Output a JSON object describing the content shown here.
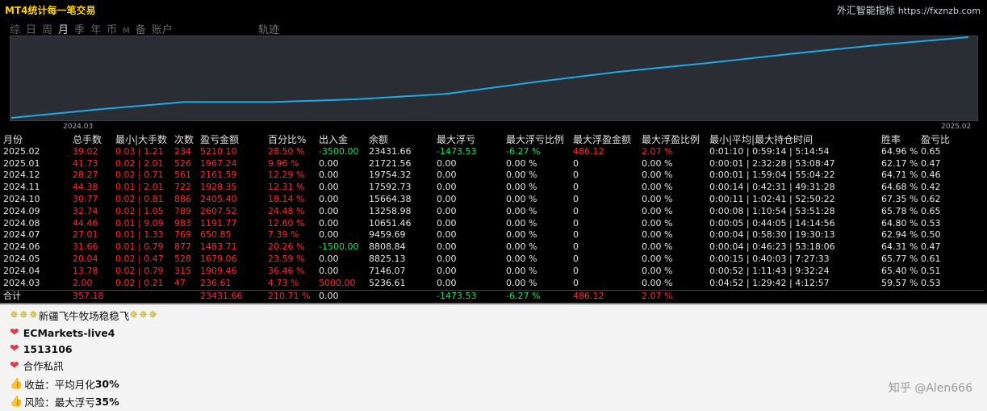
{
  "header": {
    "title": "MT4统计每一笔交易",
    "brand_name": "外汇智能指标",
    "brand_url": "https://fxznzb.com"
  },
  "tabs": [
    "综",
    "日",
    "周",
    "月",
    "季",
    "年",
    "币",
    "M",
    "备",
    "账户"
  ],
  "active_tab": "月",
  "track_label": "轨迹",
  "chart_data": {
    "type": "line",
    "x": [
      "2024.03",
      "2024.04",
      "2024.05",
      "2024.06",
      "2024.07",
      "2024.08",
      "2024.09",
      "2024.10",
      "2024.11",
      "2024.12",
      "2025.01",
      "2025.02"
    ],
    "series": [
      {
        "values": [
          5236.61,
          7146.07,
          8825.13,
          8808.84,
          9459.69,
          10651.46,
          13258.98,
          15664.38,
          17592.73,
          19754.32,
          21721.56,
          23431.66
        ]
      }
    ],
    "tick_labels": [
      "2024.03",
      "2025.02"
    ],
    "line_color": "#20a8e8"
  },
  "table": {
    "headers": [
      "月份",
      "总手数",
      "最小|大手数",
      "次数",
      "盈亏金额",
      "百分比%",
      "出入金",
      "余额",
      "最大浮亏",
      "最大浮亏比例",
      "最大浮盈金额",
      "最大浮盈比例",
      "最小|平均|最大持仓时间",
      "胜率",
      "盈亏比"
    ],
    "rows": [
      [
        "2025.02",
        "39.02",
        "0.03 | 1.21",
        "234",
        "5210.10",
        "28.50 %",
        "-3500.00",
        "23431.66",
        "-1473.53",
        "-6.27 %",
        "486.12",
        "2.07 %",
        "0:01:10 | 0:59:14 | 5:14:54",
        "64.96 %",
        "0.65"
      ],
      [
        "2025.01",
        "41.73",
        "0.02 | 2.01",
        "526",
        "1967.24",
        "9.96 %",
        "0.00",
        "21721.56",
        "0.00",
        "0.00 %",
        "0",
        "0.00 %",
        "0:00:01 | 2:32:28 | 53:08:47",
        "62.17 %",
        "0.47"
      ],
      [
        "2024.12",
        "28.27",
        "0.02 | 0.71",
        "561",
        "2161.59",
        "12.29 %",
        "0.00",
        "19754.32",
        "0.00",
        "0.00 %",
        "0",
        "0.00 %",
        "0:00:01 | 1:59:04 | 55:04:22",
        "64.71 %",
        "0.46"
      ],
      [
        "2024.11",
        "44.38",
        "0.01 | 2.01",
        "722",
        "1928.35",
        "12.31 %",
        "0.00",
        "17592.73",
        "0.00",
        "0.00 %",
        "0",
        "0.00 %",
        "0:00:14 | 0:42:31 | 49:31:28",
        "64.68 %",
        "0.42"
      ],
      [
        "2024.10",
        "30.77",
        "0.02 | 0.81",
        "886",
        "2405.40",
        "18.14 %",
        "0.00",
        "15664.38",
        "0.00",
        "0.00 %",
        "0",
        "0.00 %",
        "0:00:11 | 1:02:41 | 52:50:22",
        "67.35 %",
        "0.62"
      ],
      [
        "2024.09",
        "32.74",
        "0.02 | 1.05",
        "789",
        "2607.52",
        "24.48 %",
        "0.00",
        "13258.98",
        "0.00",
        "0.00 %",
        "0",
        "0.00 %",
        "0:00:08 | 1:10:54 | 53:51:28",
        "65.78 %",
        "0.65"
      ],
      [
        "2024.08",
        "44.46",
        "0.01 | 9.09",
        "983",
        "1191.77",
        "12.60 %",
        "0.00",
        "10651.46",
        "0.00",
        "0.00 %",
        "0",
        "0.00 %",
        "0:00:05 | 0:44:05 | 14:14:56",
        "64.80 %",
        "0.53"
      ],
      [
        "2024.07",
        "27.01",
        "0.01 | 1.33",
        "769",
        "650.85",
        "7.39 %",
        "0.00",
        "9459.69",
        "0.00",
        "0.00 %",
        "0",
        "0.00 %",
        "0:00:04 | 0:58:30 | 19:30:13",
        "62.94 %",
        "0.50"
      ],
      [
        "2024.06",
        "31.66",
        "0.01 | 0.79",
        "877",
        "1483.71",
        "20.26 %",
        "-1500.00",
        "8808.84",
        "0.00",
        "0.00 %",
        "0",
        "0.00 %",
        "0:00:04 | 0:46:23 | 53:18:06",
        "64.31 %",
        "0.47"
      ],
      [
        "2024.05",
        "20.04",
        "0.02 | 0.47",
        "528",
        "1679.06",
        "23.59 %",
        "0.00",
        "8825.13",
        "0.00",
        "0.00 %",
        "0",
        "0.00 %",
        "0:00:15 | 0:40:03 | 7:27:33",
        "65.77 %",
        "0.61"
      ],
      [
        "2024.04",
        "13.78",
        "0.02 | 0.79",
        "315",
        "1909.46",
        "36.46 %",
        "0.00",
        "7146.07",
        "0.00",
        "0.00 %",
        "0",
        "0.00 %",
        "0:00:52 | 1:11:43 | 9:32:24",
        "65.40 %",
        "0.51"
      ],
      [
        "2024.03",
        "2.00",
        "0.02 | 0.21",
        "47",
        "236.61",
        "4.73 %",
        "5000.00",
        "5236.61",
        "0.00",
        "0.00 %",
        "0",
        "0.00 %",
        "0:04:52 | 1:29:42 | 4:12:57",
        "59.57 %",
        "0.53"
      ]
    ],
    "total": [
      "合计",
      "357.18",
      "",
      "",
      "23431.66",
      "210.71 %",
      "0.00",
      "",
      "-1473.53",
      "-6.27 %",
      "486.12",
      "2.07 %",
      "",
      "",
      ""
    ]
  },
  "footer": {
    "line1": "新疆飞牛牧场稳稳飞",
    "account": "ECMarkets-live4",
    "number": "1513106",
    "contact": "合作私訊",
    "profit_prefix": "收益：平均月化",
    "profit_value": "30%",
    "risk_prefix": "风险：最大浮亏",
    "risk_value": "35%"
  },
  "watermark": "知乎 @Alen666"
}
